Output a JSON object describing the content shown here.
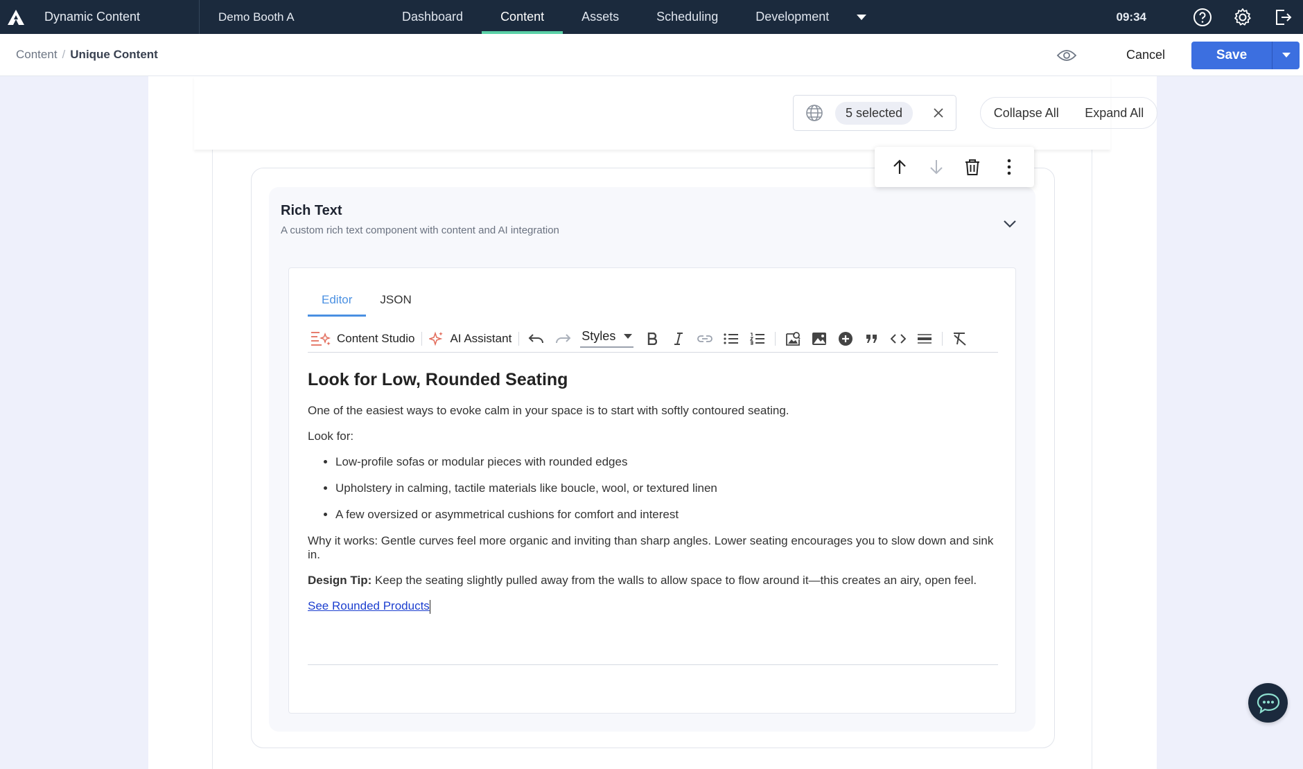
{
  "app": {
    "title": "Dynamic Content",
    "hub": "Demo Booth A"
  },
  "nav": {
    "tabs": [
      "Dashboard",
      "Content",
      "Assets",
      "Scheduling",
      "Development"
    ],
    "active": "Content"
  },
  "clock": "09:34",
  "breadcrumb": {
    "root": "Content",
    "separator": "/",
    "current": "Unique Content"
  },
  "actions": {
    "cancel": "Cancel",
    "save": "Save"
  },
  "locale": {
    "selected": "5 selected"
  },
  "expand": {
    "collapse_all": "Collapse All",
    "expand_all": "Expand All"
  },
  "component": {
    "title": "Rich Text",
    "description": "A custom rich text component with content and AI integration"
  },
  "editor": {
    "tabs": [
      "Editor",
      "JSON"
    ],
    "active_tab": "Editor",
    "toolbar": {
      "content_studio": "Content Studio",
      "ai_assistant": "AI Assistant",
      "styles": "Styles"
    },
    "content": {
      "heading": "Look for Low, Rounded Seating",
      "intro": "One of the easiest ways to evoke calm in your space is to start with softly contoured seating.",
      "look_for": "Look for:",
      "bullets": [
        "Low-profile sofas or modular pieces with rounded edges",
        "Upholstery in calming, tactile materials like boucle, wool, or textured linen",
        "A few oversized or asymmetrical cushions for comfort and interest"
      ],
      "why": "Why it works: Gentle curves feel more organic and inviting than sharp angles. Lower seating encourages you to slow down and sink in.",
      "tip_label": "Design Tip:",
      "tip_text": " Keep the seating slightly pulled away from the walls to allow space to flow around it—this creates an airy, open feel.",
      "link": "See Rounded Products"
    }
  },
  "colors": {
    "topbar": "#1b2a3d",
    "accent_nav": "#5ad0a6",
    "primary": "#3c6fe0",
    "link": "#1c3fcf",
    "tab_active": "#4a90e2"
  }
}
